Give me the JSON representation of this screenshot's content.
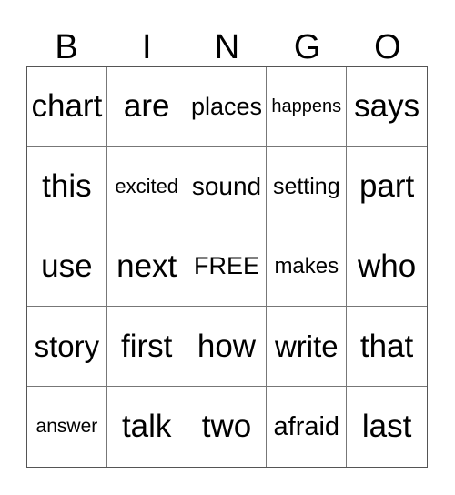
{
  "card": {
    "header": [
      "B",
      "I",
      "N",
      "G",
      "O"
    ],
    "rows": [
      [
        "chart",
        "are",
        "places",
        "happens",
        "says"
      ],
      [
        "this",
        "excited",
        "sound",
        "setting",
        "part"
      ],
      [
        "use",
        "next",
        "FREE",
        "makes",
        "who"
      ],
      [
        "story",
        "first",
        "how",
        "write",
        "that"
      ],
      [
        "answer",
        "talk",
        "two",
        "afraid",
        "last"
      ]
    ]
  }
}
